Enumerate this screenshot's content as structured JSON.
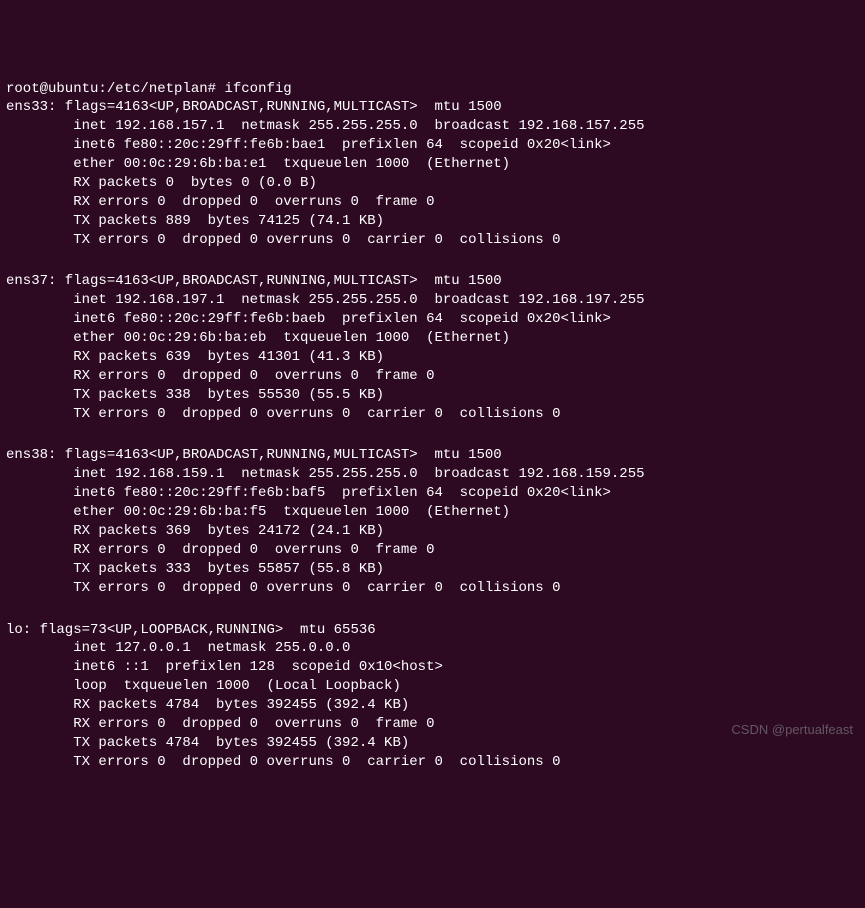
{
  "prompt": {
    "user_host": "root@ubuntu",
    "sep1": ":",
    "path": "/etc/netplan",
    "sep2": "# ",
    "command": "ifconfig"
  },
  "interfaces": {
    "ens33": {
      "header": "ens33: flags=4163<UP,BROADCAST,RUNNING,MULTICAST>  mtu 1500",
      "inet": "        inet 192.168.157.1  netmask 255.255.255.0  broadcast 192.168.157.255",
      "inet6": "        inet6 fe80::20c:29ff:fe6b:bae1  prefixlen 64  scopeid 0x20<link>",
      "ether": "        ether 00:0c:29:6b:ba:e1  txqueuelen 1000  (Ethernet)",
      "rxp": "        RX packets 0  bytes 0 (0.0 B)",
      "rxe": "        RX errors 0  dropped 0  overruns 0  frame 0",
      "txp": "        TX packets 889  bytes 74125 (74.1 KB)",
      "txe": "        TX errors 0  dropped 0 overruns 0  carrier 0  collisions 0"
    },
    "ens37": {
      "header": "ens37: flags=4163<UP,BROADCAST,RUNNING,MULTICAST>  mtu 1500",
      "inet": "        inet 192.168.197.1  netmask 255.255.255.0  broadcast 192.168.197.255",
      "inet6": "        inet6 fe80::20c:29ff:fe6b:baeb  prefixlen 64  scopeid 0x20<link>",
      "ether": "        ether 00:0c:29:6b:ba:eb  txqueuelen 1000  (Ethernet)",
      "rxp": "        RX packets 639  bytes 41301 (41.3 KB)",
      "rxe": "        RX errors 0  dropped 0  overruns 0  frame 0",
      "txp": "        TX packets 338  bytes 55530 (55.5 KB)",
      "txe": "        TX errors 0  dropped 0 overruns 0  carrier 0  collisions 0"
    },
    "ens38": {
      "header": "ens38: flags=4163<UP,BROADCAST,RUNNING,MULTICAST>  mtu 1500",
      "inet": "        inet 192.168.159.1  netmask 255.255.255.0  broadcast 192.168.159.255",
      "inet6": "        inet6 fe80::20c:29ff:fe6b:baf5  prefixlen 64  scopeid 0x20<link>",
      "ether": "        ether 00:0c:29:6b:ba:f5  txqueuelen 1000  (Ethernet)",
      "rxp": "        RX packets 369  bytes 24172 (24.1 KB)",
      "rxe": "        RX errors 0  dropped 0  overruns 0  frame 0",
      "txp": "        TX packets 333  bytes 55857 (55.8 KB)",
      "txe": "        TX errors 0  dropped 0 overruns 0  carrier 0  collisions 0"
    },
    "lo": {
      "header": "lo: flags=73<UP,LOOPBACK,RUNNING>  mtu 65536",
      "inet": "        inet 127.0.0.1  netmask 255.0.0.0",
      "inet6": "        inet6 ::1  prefixlen 128  scopeid 0x10<host>",
      "ether": "        loop  txqueuelen 1000  (Local Loopback)",
      "rxp": "        RX packets 4784  bytes 392455 (392.4 KB)",
      "rxe": "        RX errors 0  dropped 0  overruns 0  frame 0",
      "txp": "        TX packets 4784  bytes 392455 (392.4 KB)",
      "txe": "        TX errors 0  dropped 0 overruns 0  carrier 0  collisions 0"
    }
  },
  "watermark": "CSDN @pertualfeast"
}
